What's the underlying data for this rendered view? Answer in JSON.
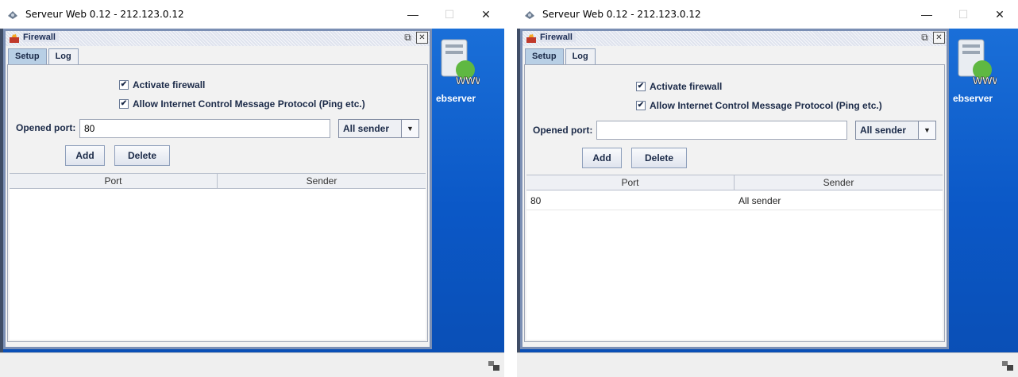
{
  "panels": [
    {
      "window_title": "Serveur Web 0.12 - 212.123.0.12",
      "desktop_icon_label": "ebserver",
      "frame_title": "Firewall",
      "tabs": [
        {
          "label": "Setup",
          "active": true
        },
        {
          "label": "Log",
          "active": false
        }
      ],
      "activate_firewall_label": "Activate firewall",
      "activate_firewall_checked": true,
      "icmp_label": "Allow Internet Control Message Protocol (Ping etc.)",
      "icmp_checked": true,
      "opened_port_label": "Opened port:",
      "opened_port_value": "80",
      "sender_selected": "All sender",
      "add_label": "Add",
      "delete_label": "Delete",
      "table": {
        "columns": [
          "Port",
          "Sender"
        ],
        "rows": []
      }
    },
    {
      "window_title": "Serveur Web 0.12 - 212.123.0.12",
      "desktop_icon_label": "ebserver",
      "frame_title": "Firewall",
      "tabs": [
        {
          "label": "Setup",
          "active": true
        },
        {
          "label": "Log",
          "active": false
        }
      ],
      "activate_firewall_label": "Activate firewall",
      "activate_firewall_checked": true,
      "icmp_label": "Allow Internet Control Message Protocol (Ping etc.)",
      "icmp_checked": true,
      "opened_port_label": "Opened port:",
      "opened_port_value": "",
      "sender_selected": "All sender",
      "add_label": "Add",
      "delete_label": "Delete",
      "table": {
        "columns": [
          "Port",
          "Sender"
        ],
        "rows": [
          {
            "port": "80",
            "sender": "All sender"
          }
        ]
      }
    }
  ],
  "window_controls": {
    "minimize": "—",
    "maximize": "☐",
    "close": "✕"
  },
  "icons": {
    "app": "server-app-icon",
    "firewall": "firewall-icon",
    "maximize_frame": "maximize-frame-icon",
    "close_frame": "close-frame-icon",
    "network_status": "network-status-icon"
  }
}
